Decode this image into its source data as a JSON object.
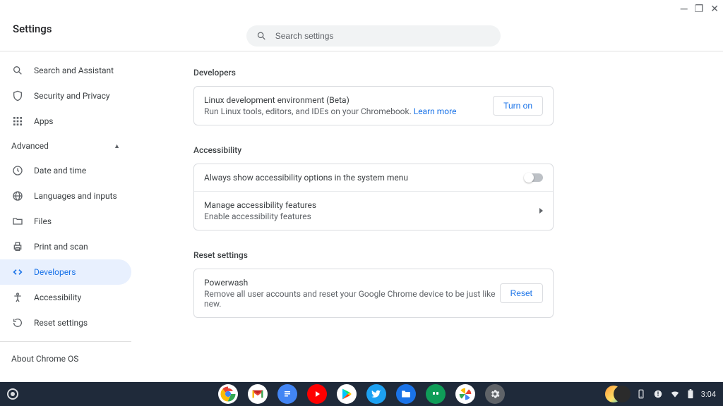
{
  "window": {
    "title": "Settings"
  },
  "search": {
    "placeholder": "Search settings"
  },
  "sidebar": {
    "items_top": [
      {
        "label": "Search and Assistant",
        "icon": "search"
      },
      {
        "label": "Security and Privacy",
        "icon": "shield"
      },
      {
        "label": "Apps",
        "icon": "apps"
      }
    ],
    "advanced_label": "Advanced",
    "items_advanced": [
      {
        "label": "Date and time",
        "icon": "clock"
      },
      {
        "label": "Languages and inputs",
        "icon": "globe"
      },
      {
        "label": "Files",
        "icon": "folder"
      },
      {
        "label": "Print and scan",
        "icon": "printer"
      },
      {
        "label": "Developers",
        "icon": "code",
        "active": true
      },
      {
        "label": "Accessibility",
        "icon": "accessibility"
      },
      {
        "label": "Reset settings",
        "icon": "reset"
      }
    ],
    "about_label": "About Chrome OS"
  },
  "sections": {
    "developers": {
      "title": "Developers",
      "linux_title": "Linux development environment (Beta)",
      "linux_sub": "Run Linux tools, editors, and IDEs on your Chromebook. ",
      "linux_learn": "Learn more",
      "turn_on": "Turn on"
    },
    "accessibility": {
      "title": "Accessibility",
      "always_show": "Always show accessibility options in the system menu",
      "manage_title": "Manage accessibility features",
      "manage_sub": "Enable accessibility features"
    },
    "reset": {
      "title": "Reset settings",
      "powerwash_title": "Powerwash",
      "powerwash_sub": "Remove all user accounts and reset your Google Chrome device to be just like new.",
      "reset_btn": "Reset"
    }
  },
  "shelf": {
    "clock": "3:04"
  }
}
